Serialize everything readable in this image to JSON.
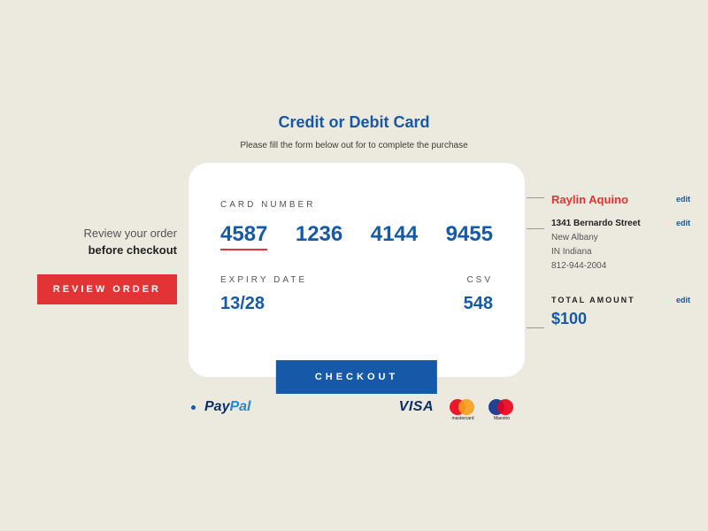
{
  "header": {
    "title": "Credit or Debit Card",
    "subtitle": "Please fill the form below out for to complete the purchase"
  },
  "left": {
    "line1": "Review your order",
    "line2": "before checkout",
    "review_btn": "REVIEW ORDER"
  },
  "card": {
    "card_number_label": "CARD NUMBER",
    "n1": "4587",
    "n2": "1236",
    "n3": "4144",
    "n4": "9455",
    "expiry_label": "EXPIRY DATE",
    "expiry_value": "13/28",
    "csv_label": "CSV",
    "csv_value": "548",
    "checkout_btn": "CHECKOUT"
  },
  "info": {
    "name": "Raylin Aquino",
    "street": "1341  Bernardo Street",
    "city": "New Albany",
    "state": "IN Indiana",
    "phone": "812-944-2004",
    "total_label": "TOTAL AMOUNT",
    "amount": "$100",
    "edit": "edit"
  },
  "logos": {
    "paypal1": "Pay",
    "paypal2": "Pal",
    "visa": "VISA",
    "mastercard": "mastercard",
    "maestro": "Maestro"
  }
}
